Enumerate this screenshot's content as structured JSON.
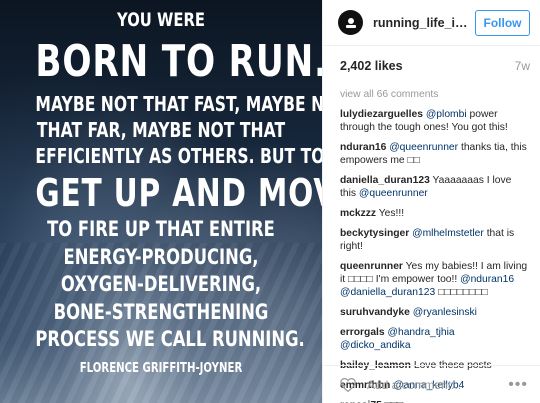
{
  "image": {
    "quote": {
      "line1": "YOU WERE",
      "line2": "BORN TO RUN.",
      "line3": [
        "MAYBE NOT THAT FAST, MAYBE NOT",
        "THAT FAR, MAYBE NOT THAT",
        "EFFICIENTLY AS OTHERS. BUT TO"
      ],
      "line4": "GET UP AND MOVE,",
      "line5": [
        "TO FIRE UP THAT ENTIRE",
        "ENERGY-PRODUCING,",
        "OXYGEN-DELIVERING,",
        "BONE-STRENGTHENING",
        "PROCESS WE CALL RUNNING."
      ],
      "author": "FLORENCE GRIFFITH-JOYNER"
    }
  },
  "header": {
    "username": "running_life_inspirat...",
    "follow_label": "Follow"
  },
  "stats": {
    "likes": "2,402 likes",
    "age": "7w"
  },
  "comments": {
    "view_all": "view all 66 comments",
    "items": [
      {
        "author": "lulydiezarguelles",
        "mention": "@plombi",
        "text": " power through the tough ones! You got this!"
      },
      {
        "author": "nduran16",
        "mention": "@queenrunner",
        "text": " thanks tia, this empowers me □□"
      },
      {
        "author": "daniella_duran123",
        "pre": "Yaaaaaaas I love this ",
        "mention": "@queenrunner",
        "text": ""
      },
      {
        "author": "mckzzz",
        "pre": "Yes!!!",
        "mention": "",
        "text": ""
      },
      {
        "author": "beckytysinger",
        "mention": "@mlhelmstetler",
        "text": " that is right!"
      },
      {
        "author": "queenrunner",
        "pre": "Yes my babies!! I am living it □□□□ I'm empower too!! ",
        "mention": "@nduran16",
        "mention2": "@daniella_duran123",
        "text": " □□□□□□□□"
      },
      {
        "author": "suruhvandyke",
        "mention": "@ryanlesinski",
        "text": ""
      },
      {
        "author": "errorgals",
        "mention": "@handra_tjhia",
        "mention2": "@dicko_andika",
        "text": ""
      },
      {
        "author": "bailey_leamon",
        "pre": "Love these posts",
        "mention": "",
        "text": ""
      },
      {
        "author": "emmrthbn",
        "mention": "@anna_kellyb4",
        "text": ""
      },
      {
        "author": "rencsi75",
        "pre": "□□□",
        "mention": "",
        "text": ""
      }
    ]
  },
  "add_comment": {
    "placeholder": "Add a comment...",
    "more_label": "•••"
  },
  "colors": {
    "accent": "#3897f0",
    "mention": "#003569",
    "muted": "#999999"
  },
  "icons": [
    "heart-icon",
    "avatar-logo-icon"
  ]
}
